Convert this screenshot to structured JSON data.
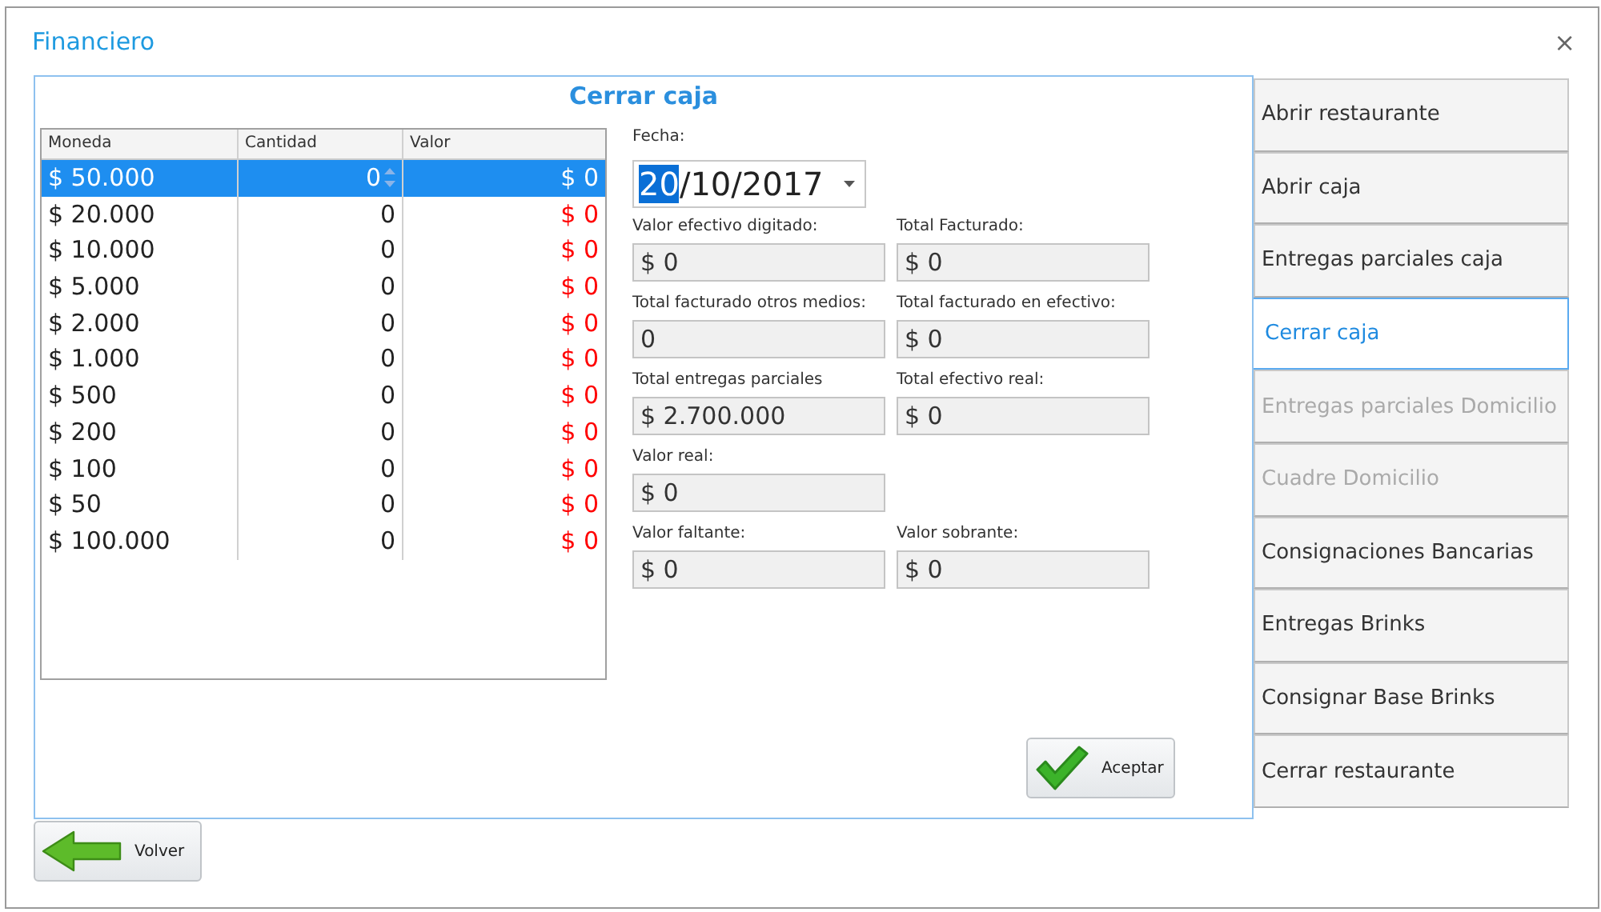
{
  "window": {
    "title": "Financiero",
    "close": "×"
  },
  "panel": {
    "title": "Cerrar caja"
  },
  "table": {
    "columns": [
      "Moneda",
      "Cantidad",
      "Valor"
    ],
    "rows": [
      {
        "moneda": "$ 50.000",
        "cantidad": "0",
        "valor": "$ 0",
        "selected": true
      },
      {
        "moneda": "$ 20.000",
        "cantidad": "0",
        "valor": "$ 0",
        "selected": false
      },
      {
        "moneda": "$ 10.000",
        "cantidad": "0",
        "valor": "$ 0",
        "selected": false
      },
      {
        "moneda": "$ 5.000",
        "cantidad": "0",
        "valor": "$ 0",
        "selected": false
      },
      {
        "moneda": "$ 2.000",
        "cantidad": "0",
        "valor": "$ 0",
        "selected": false
      },
      {
        "moneda": "$ 1.000",
        "cantidad": "0",
        "valor": "$ 0",
        "selected": false
      },
      {
        "moneda": "$ 500",
        "cantidad": "0",
        "valor": "$ 0",
        "selected": false
      },
      {
        "moneda": "$ 200",
        "cantidad": "0",
        "valor": "$ 0",
        "selected": false
      },
      {
        "moneda": "$ 100",
        "cantidad": "0",
        "valor": "$ 0",
        "selected": false
      },
      {
        "moneda": "$ 50",
        "cantidad": "0",
        "valor": "$ 0",
        "selected": false
      },
      {
        "moneda": "$ 100.000",
        "cantidad": "0",
        "valor": "$ 0",
        "selected": false
      }
    ]
  },
  "date": {
    "label": "Fecha:",
    "segments": [
      {
        "text": "20",
        "selected": true
      },
      {
        "text": "/10/2017",
        "selected": false
      }
    ]
  },
  "fields": [
    {
      "label": "Valor efectivo digitado:",
      "value": "$ 0"
    },
    {
      "label": "Total Facturado:",
      "value": "$ 0"
    },
    {
      "label": "Total facturado otros medios:",
      "value": "0"
    },
    {
      "label": "Total facturado en efectivo:",
      "value": "$ 0"
    },
    {
      "label": "Total entregas parciales",
      "value": "$ 2.700.000"
    },
    {
      "label": "Total efectivo real:",
      "value": "$ 0"
    },
    {
      "label": "Valor real:",
      "value": "$ 0"
    },
    {
      "kind": "empty"
    },
    {
      "label": "Valor faltante:",
      "value": "$ 0"
    },
    {
      "label": "Valor sobrante:",
      "value": "$ 0"
    }
  ],
  "accept_button": "Aceptar",
  "back_button": "Volver",
  "tabs": [
    {
      "label": "Abrir restaurante",
      "selected": false,
      "disabled": false
    },
    {
      "label": "Abrir caja",
      "selected": false,
      "disabled": false
    },
    {
      "label": "Entregas parciales caja",
      "selected": false,
      "disabled": false
    },
    {
      "label": "Cerrar caja",
      "selected": true,
      "disabled": false
    },
    {
      "label": "Entregas parciales Domicilio",
      "selected": false,
      "disabled": true
    },
    {
      "label": "Cuadre Domicilio",
      "selected": false,
      "disabled": true
    },
    {
      "label": "Consignaciones Bancarias",
      "selected": false,
      "disabled": false
    },
    {
      "label": "Entregas Brinks",
      "selected": false,
      "disabled": false
    },
    {
      "label": "Consignar Base Brinks",
      "selected": false,
      "disabled": false
    },
    {
      "label": "Cerrar restaurante",
      "selected": false,
      "disabled": false
    }
  ]
}
